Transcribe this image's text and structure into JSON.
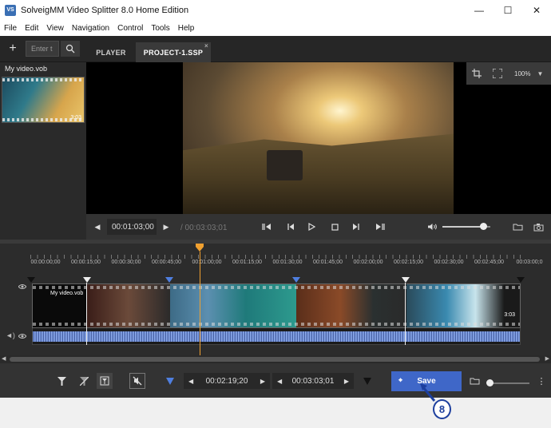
{
  "window": {
    "title": "SolveigMM Video Splitter 8.0 Home Edition",
    "app_icon": "VS",
    "minimize": "—",
    "maximize": "☐",
    "close": "✕"
  },
  "menu": [
    "File",
    "Edit",
    "View",
    "Navigation",
    "Control",
    "Tools",
    "Help"
  ],
  "toolbar": {
    "search_placeholder": "Enter t",
    "tabs": [
      {
        "label": "PLAYER",
        "active": false
      },
      {
        "label": "PROJECT-1.SSP",
        "active": true
      }
    ],
    "tab_close": "×"
  },
  "library": {
    "title": "My video.vob",
    "duration": "3:03"
  },
  "viewer": {
    "zoom": "100%"
  },
  "player": {
    "current_time": "00:01:03;00",
    "total_time": "/ 00:03:03;01",
    "volume_level": 0.85
  },
  "ruler": {
    "ticks": [
      "00:00:00;00",
      "00:00:15;00",
      "00:00:30;00",
      "00:00:45;00",
      "00:01:00;00",
      "00:01:15;00",
      "00:01:30;00",
      "00:01:45;00",
      "00:02:00;00",
      "00:02:15;00",
      "00:02:30;00",
      "00:02:45;00",
      "00:03:00;0"
    ]
  },
  "timeline": {
    "clip_name": "My video.vob",
    "clip_duration": "3:03"
  },
  "bottom": {
    "marker_in_time": "00:02:19;20",
    "marker_out_time": "00:03:03;01",
    "save_label": "Save"
  },
  "annotation": {
    "callout": "8"
  },
  "colors": {
    "accent": "#3f67c8",
    "playhead": "#f0a030",
    "selection_marker": "#4f7fe0",
    "callout": "#1d3f9e"
  }
}
